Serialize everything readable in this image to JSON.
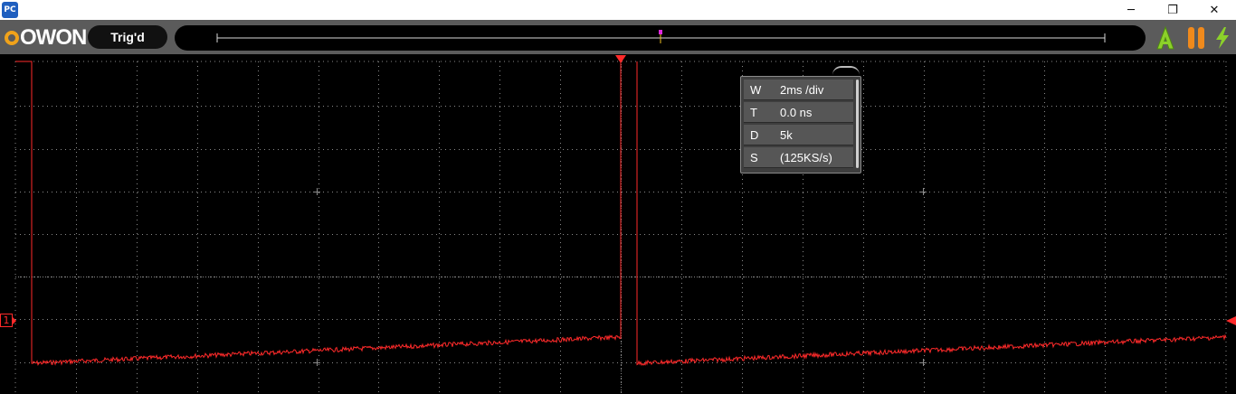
{
  "window": {
    "app_icon": "PC",
    "minimize_icon": "─",
    "restore_icon": "❐",
    "close_icon": "✕"
  },
  "toolbar": {
    "logo": "OWON",
    "trigger_status": "Trig'd",
    "auto_icon": "auto-set-icon",
    "run_stop_icon": "pause-icon",
    "quick_icon": "lightning-icon"
  },
  "timebase": {
    "rows": [
      {
        "key": "W",
        "value": "2ms /div"
      },
      {
        "key": "T",
        "value": "0.0 ns"
      },
      {
        "key": "D",
        "value": "5k"
      },
      {
        "key": "S",
        "value": "(125KS/s)"
      }
    ]
  },
  "channel": {
    "label": "1",
    "color": "#ff2a2a"
  },
  "colors": {
    "accent_logo": "#f0a21a",
    "run_stop": "#f08a1c",
    "auto_green": "#8cd12a",
    "timeline_marker": "#e028e0"
  }
}
